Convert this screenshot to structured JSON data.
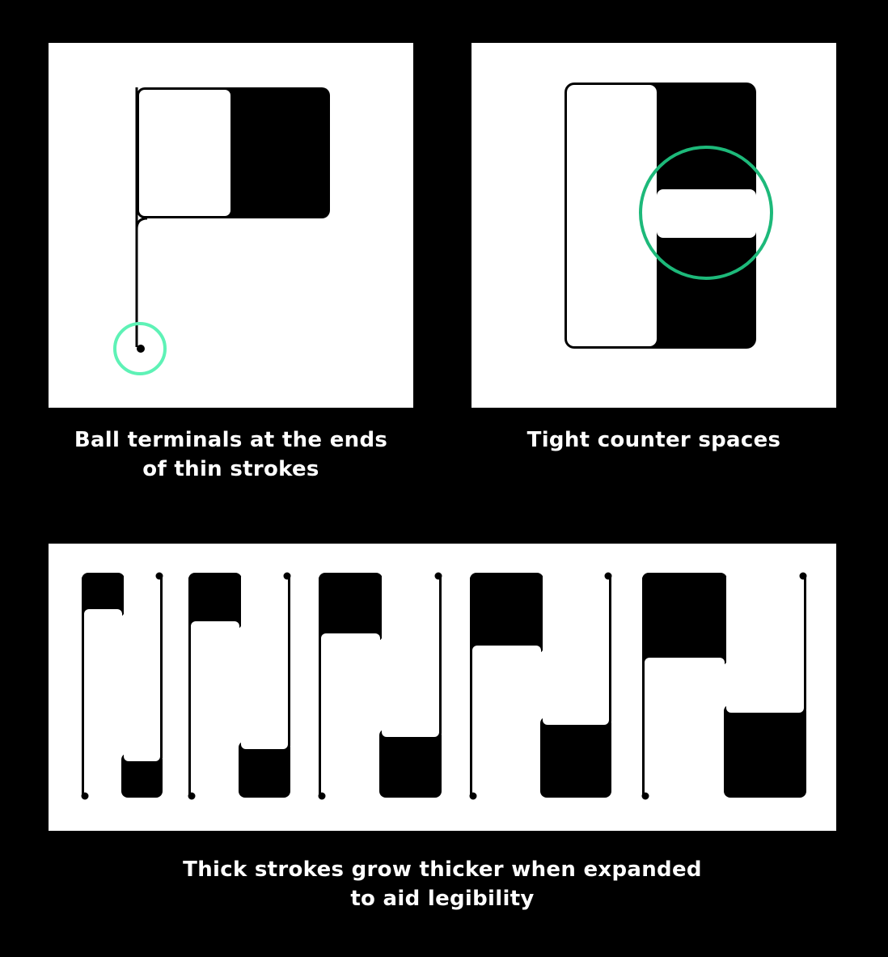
{
  "panels": {
    "ball_terminals": {
      "caption_lines": [
        "Ball terminals at the ends",
        "of thin strokes"
      ],
      "highlight_color": "#5EF2B6"
    },
    "counter_spaces": {
      "caption_lines": [
        "Tight counter spaces"
      ],
      "highlight_color": "#1DB97A"
    },
    "thick_strokes": {
      "caption_lines": [
        "Thick strokes grow thicker when expanded",
        "to aid legibility"
      ]
    }
  },
  "colors": {
    "background": "#000000",
    "panel": "#FFFFFF",
    "ink": "#000000"
  }
}
